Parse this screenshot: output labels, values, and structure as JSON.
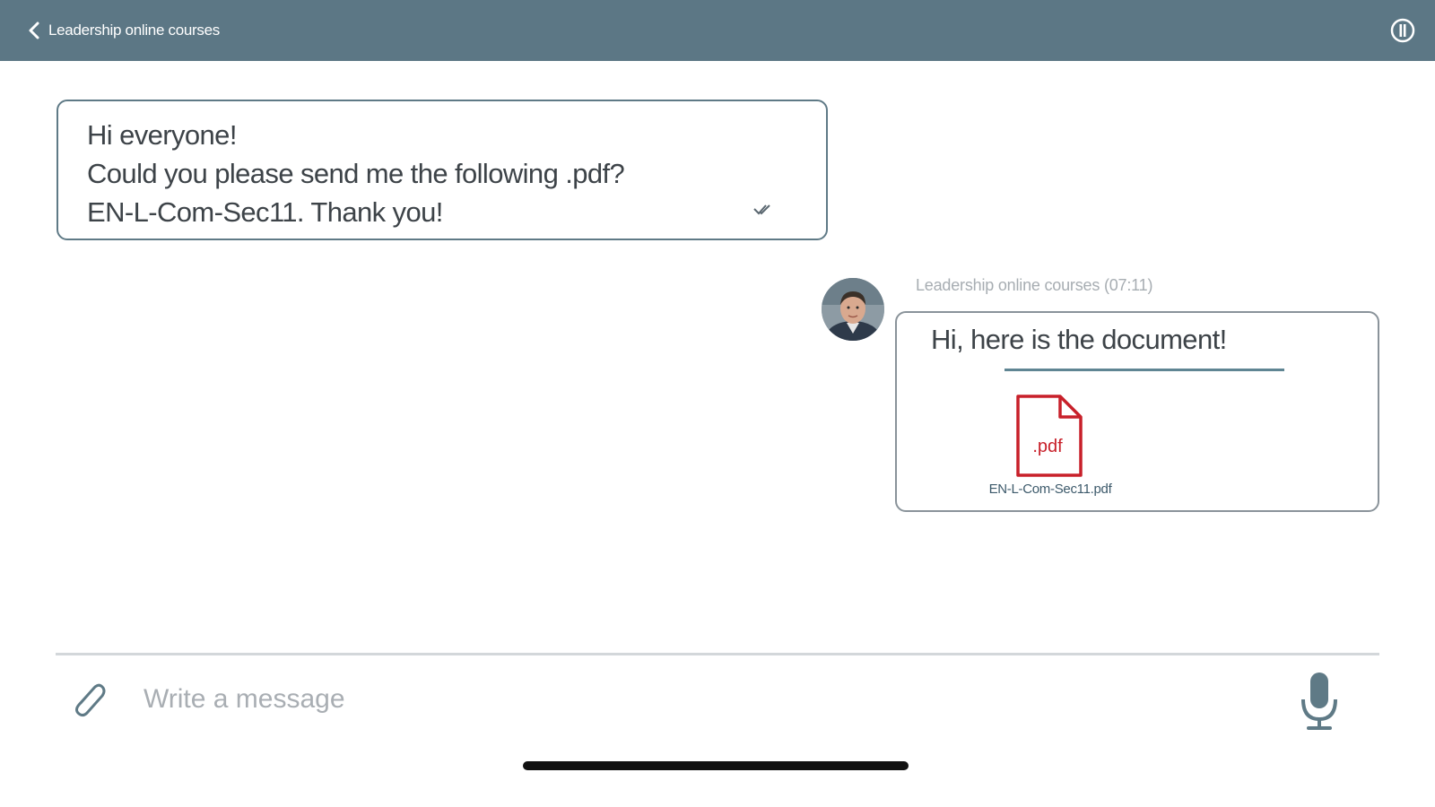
{
  "header": {
    "back_label": "Leadership online courses",
    "back_icon": "chevron-left-icon",
    "info_icon": "info-icon"
  },
  "messages": {
    "outgoing": {
      "lines": [
        "Hi everyone!",
        "Could you please send me the following .pdf?",
        "EN-L-Com-Sec11. Thank you!"
      ],
      "status_icon": "read-check-icon"
    },
    "incoming": {
      "sender_meta": "Leadership online courses (07:11)",
      "text": "Hi, here is the document!",
      "attachment": {
        "icon_label": ".pdf",
        "file_name": "EN-L-Com-Sec11.pdf"
      }
    }
  },
  "composer": {
    "placeholder": "Write a message",
    "value": "",
    "attach_icon": "paperclip-icon",
    "mic_icon": "microphone-icon"
  },
  "colors": {
    "header_bg": "#5c7785",
    "outgoing_border": "#5f7a86",
    "pdf_red": "#c8202a"
  }
}
